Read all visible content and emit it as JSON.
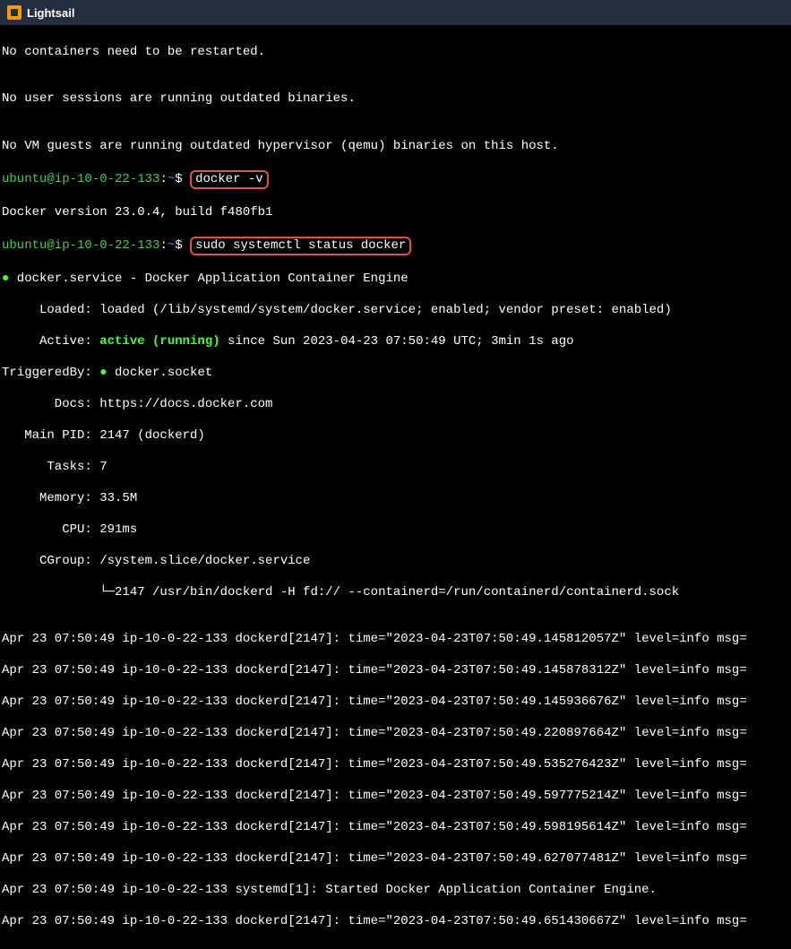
{
  "header": {
    "title": "Lightsail"
  },
  "terminal": {
    "line1": "No containers need to be restarted.",
    "line2": "",
    "line3": "No user sessions are running outdated binaries.",
    "line4": "",
    "line5": "No VM guests are running outdated hypervisor (qemu) binaries on this host.",
    "prompt_user": "ubuntu@ip-10-0-22-133",
    "prompt_sep": ":",
    "prompt_path": "~",
    "prompt_end": "$ ",
    "cmd1": "docker -v",
    "docker_version": "Docker version 23.0.4, build f480fb1",
    "cmd2": "sudo systemctl status docker",
    "svc_header": " docker.service - Docker Application Container Engine",
    "loaded_label": "     Loaded: ",
    "loaded_value": "loaded (/lib/systemd/system/docker.service; enabled; vendor preset: enabled)",
    "active_label": "     Active: ",
    "active_status": "active (running)",
    "active_rest": " since Sun 2023-04-23 07:50:49 UTC; 3min 1s ago",
    "triggered_label": "TriggeredBy: ",
    "triggered_value": " docker.socket",
    "docs_label": "       Docs: ",
    "docs_value": "https://docs.docker.com",
    "pid_label": "   Main PID: ",
    "pid_value": "2147 (dockerd)",
    "tasks_label": "      Tasks: ",
    "tasks_value": "7",
    "memory_label": "     Memory: ",
    "memory_value": "33.5M",
    "cpu_label": "        CPU: ",
    "cpu_value": "291ms",
    "cgroup_label": "     CGroup: ",
    "cgroup_value": "/system.slice/docker.service",
    "cgroup_child": "             └─2147 /usr/bin/dockerd -H fd:// --containerd=/run/containerd/containerd.sock",
    "blank": "",
    "log1": "Apr 23 07:50:49 ip-10-0-22-133 dockerd[2147]: time=\"2023-04-23T07:50:49.145812057Z\" level=info msg=",
    "log2": "Apr 23 07:50:49 ip-10-0-22-133 dockerd[2147]: time=\"2023-04-23T07:50:49.145878312Z\" level=info msg=",
    "log3": "Apr 23 07:50:49 ip-10-0-22-133 dockerd[2147]: time=\"2023-04-23T07:50:49.145936676Z\" level=info msg=",
    "log4": "Apr 23 07:50:49 ip-10-0-22-133 dockerd[2147]: time=\"2023-04-23T07:50:49.220897664Z\" level=info msg=",
    "log5": "Apr 23 07:50:49 ip-10-0-22-133 dockerd[2147]: time=\"2023-04-23T07:50:49.535276423Z\" level=info msg=",
    "log6": "Apr 23 07:50:49 ip-10-0-22-133 dockerd[2147]: time=\"2023-04-23T07:50:49.597775214Z\" level=info msg=",
    "log7": "Apr 23 07:50:49 ip-10-0-22-133 dockerd[2147]: time=\"2023-04-23T07:50:49.598195614Z\" level=info msg=",
    "log8": "Apr 23 07:50:49 ip-10-0-22-133 dockerd[2147]: time=\"2023-04-23T07:50:49.627077481Z\" level=info msg=",
    "log9": "Apr 23 07:50:49 ip-10-0-22-133 systemd[1]: Started Docker Application Container Engine.",
    "log10": "Apr 23 07:50:49 ip-10-0-22-133 dockerd[2147]: time=\"2023-04-23T07:50:49.651430667Z\" level=info msg="
  }
}
